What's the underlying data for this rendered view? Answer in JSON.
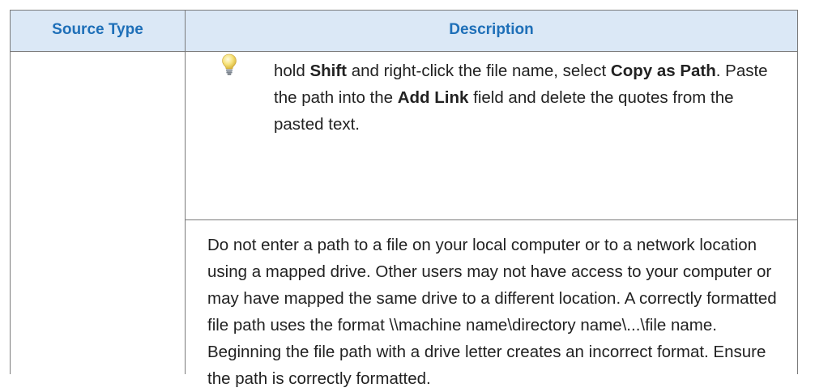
{
  "table": {
    "headers": {
      "source_type": "Source Type",
      "description": "Description"
    },
    "tip": {
      "icon": "lightbulb-icon",
      "parts": [
        {
          "text": "hold ",
          "bold": false
        },
        {
          "text": "Shift",
          "bold": true
        },
        {
          "text": " and right-click the file name, select ",
          "bold": false
        },
        {
          "text": "Copy as Path",
          "bold": true
        },
        {
          "text": ". Paste the path into the ",
          "bold": false
        },
        {
          "text": "Add Link",
          "bold": true
        },
        {
          "text": " field and delete the quotes from the pasted text.",
          "bold": false
        }
      ]
    },
    "paragraph": "Do not enter a path to a file on your local computer or to a network location using a mapped drive. Other users may not have access to your computer or may have mapped the same drive to a different location. A correctly formatted file path uses the format \\\\machine name\\directory name\\...\\file name. Beginning the file path with a drive letter creates an incorrect format. Ensure the path is correctly formatted."
  },
  "colors": {
    "header_background": "#dbe8f6",
    "header_text": "#1e6fb8",
    "body_text": "#222222",
    "border": "#7a7a7a"
  }
}
